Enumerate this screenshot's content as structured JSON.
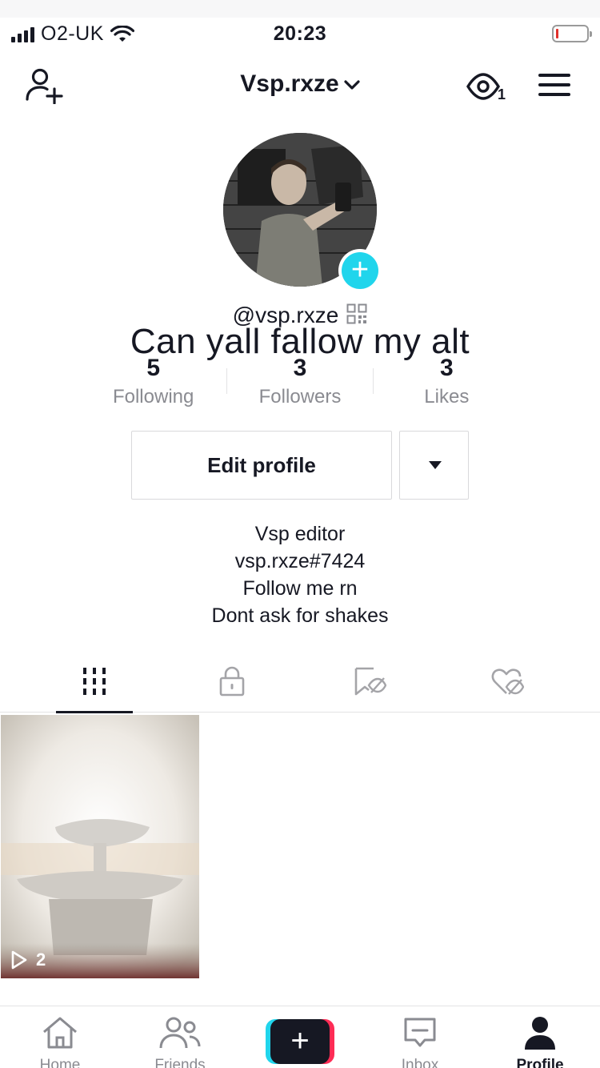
{
  "status": {
    "carrier": "O2-UK",
    "time": "20:23"
  },
  "header": {
    "username": "Vsp.rxze",
    "views_count": "1"
  },
  "profile": {
    "handle": "@vsp.rxze",
    "overlay_text": "Can yall fallow my alt",
    "stats": [
      {
        "value": "5",
        "label": "Following"
      },
      {
        "value": "3",
        "label": "Followers"
      },
      {
        "value": "3",
        "label": "Likes"
      }
    ],
    "edit_label": "Edit profile",
    "bio": [
      "Vsp editor",
      "vsp.rxze#7424",
      "Follow me rn",
      "Dont ask for shakes"
    ]
  },
  "tabs": [
    {
      "icon": "videos-grid-icon",
      "active": true
    },
    {
      "icon": "lock-icon",
      "active": false
    },
    {
      "icon": "bookmark-hidden-icon",
      "active": false
    },
    {
      "icon": "heart-hidden-icon",
      "active": false
    }
  ],
  "videos": [
    {
      "plays": "2"
    }
  ],
  "nav": {
    "home": "Home",
    "friends": "Friends",
    "inbox": "Inbox",
    "profile": "Profile"
  },
  "colors": {
    "accent_cyan": "#20d5ec",
    "accent_pink": "#fe2c55",
    "text": "#161823",
    "muted": "#8a8b91"
  }
}
